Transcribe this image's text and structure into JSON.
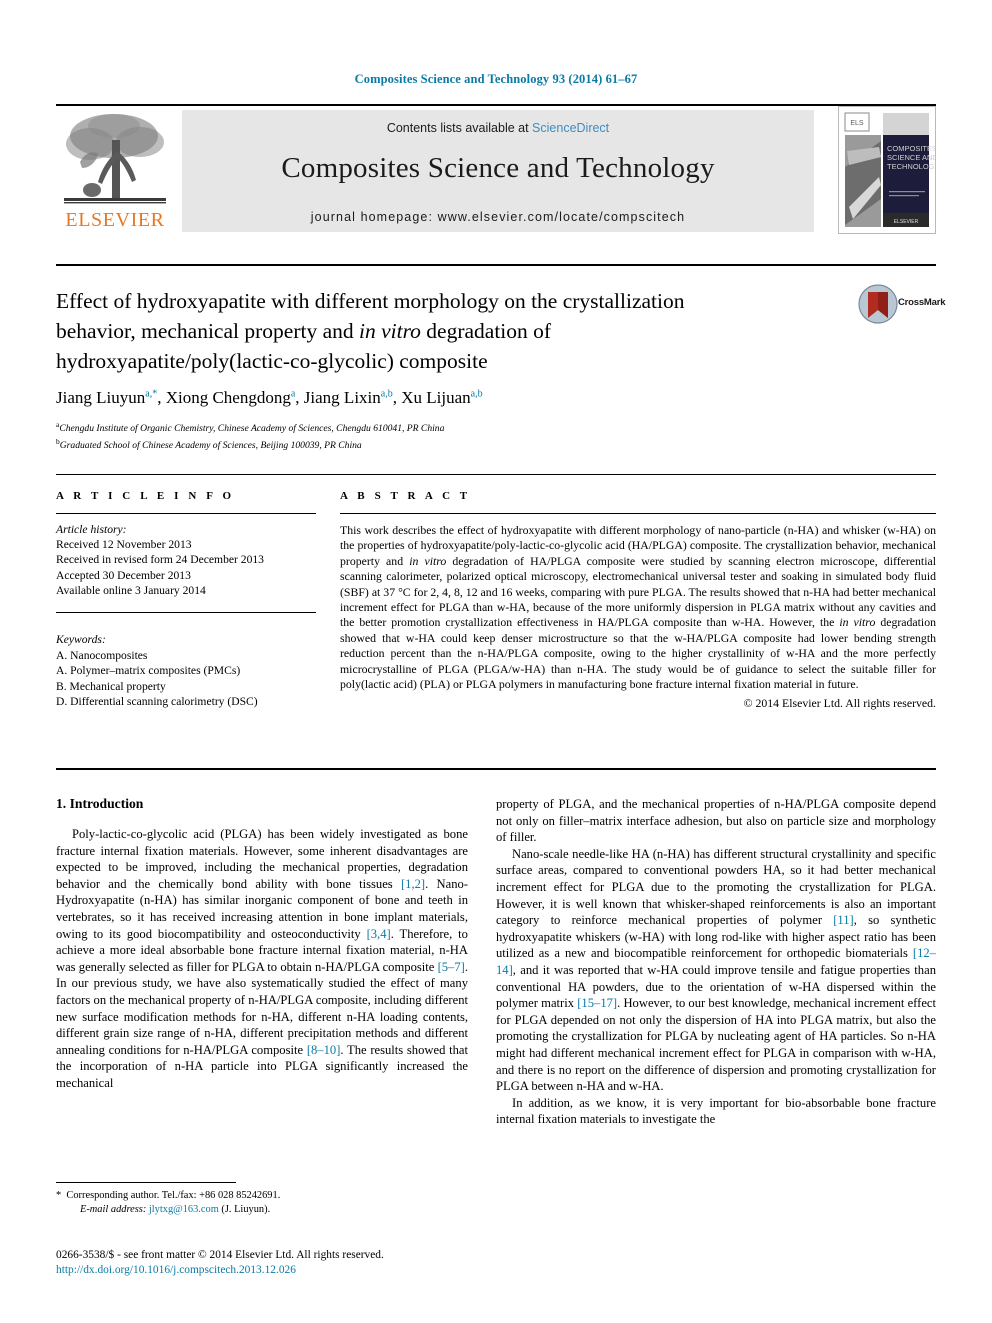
{
  "running_head": "Composites Science and Technology 93 (2014) 61–67",
  "masthead": {
    "contents_prefix": "Contents lists available at ",
    "sciencedirect": "ScienceDirect",
    "journal_title": "Composites Science and Technology",
    "homepage": "journal homepage: www.elsevier.com/locate/compscitech",
    "publisher_logo_text": "ELSEVIER",
    "cover_title": "COMPOSITES SCIENCE AND TECHNOLOGY"
  },
  "article": {
    "title_line1": "Effect of hydroxyapatite with different morphology on the crystallization",
    "title_line2_a": "behavior, mechanical property and ",
    "title_line2_i": "in vitro",
    "title_line2_b": " degradation of",
    "title_line3": "hydroxyapatite/poly(lactic-co-glycolic) composite",
    "crossmark_label": "CrossMark",
    "authors": [
      {
        "name": "Jiang Liuyun",
        "marks": "a,*"
      },
      {
        "name": "Xiong Chengdong",
        "marks": "a"
      },
      {
        "name": "Jiang Lixin",
        "marks": "a,b"
      },
      {
        "name": "Xu Lijuan",
        "marks": "a,b"
      }
    ],
    "affiliations": [
      {
        "mark": "a",
        "text": "Chengdu Institute of Organic Chemistry, Chinese Academy of Sciences, Chengdu 610041, PR China"
      },
      {
        "mark": "b",
        "text": "Graduated School of Chinese Academy of Sciences, Beijing 100039, PR China"
      }
    ]
  },
  "article_info": {
    "heading": "A R T I C L E    I N F O",
    "history_label": "Article history:",
    "history": [
      "Received 12 November 2013",
      "Received in revised form 24 December 2013",
      "Accepted 30 December 2013",
      "Available online 3 January 2014"
    ],
    "keywords_label": "Keywords:",
    "keywords": [
      "A. Nanocomposites",
      "A. Polymer–matrix composites (PMCs)",
      "B. Mechanical property",
      "D. Differential scanning calorimetry (DSC)"
    ]
  },
  "abstract": {
    "heading": "A B S T R A C T",
    "part1": "This work describes the effect of hydroxyapatite with different morphology of nano-particle (n-HA) and whisker (w-HA) on the properties of hydroxyapatite/poly-lactic-co-glycolic acid (HA/PLGA) composite. The crystallization behavior, mechanical property and ",
    "italic1": "in vitro",
    "part2": " degradation of HA/PLGA composite were studied by scanning electron microscope, differential scanning calorimeter, polarized optical microscopy, electromechanical universal tester and soaking in simulated body fluid (SBF) at 37 °C for 2, 4, 8, 12 and 16 weeks, comparing with pure PLGA. The results showed that n-HA had better mechanical increment effect for PLGA than w-HA, because of the more uniformly dispersion in PLGA matrix without any cavities and the better promotion crystallization effectiveness in HA/PLGA composite than w-HA. However, the ",
    "italic2": "in vitro",
    "part3": " degradation showed that w-HA could keep denser microstructure so that the w-HA/PLGA composite had lower bending strength reduction percent than the n-HA/PLGA composite, owing to the higher crystallinity of w-HA and the more perfectly microcrystalline of PLGA (PLGA/w-HA) than n-HA. The study would be of guidance to select the suitable filler for poly(lactic acid) (PLA) or PLGA polymers in manufacturing bone fracture internal fixation material in future.",
    "copyright": "© 2014 Elsevier Ltd. All rights reserved."
  },
  "body": {
    "section_heading": "1. Introduction",
    "left_paragraphs": [
      {
        "segments": [
          {
            "t": "Poly-lactic-co-glycolic acid (PLGA) has been widely investigated as bone fracture internal fixation materials. However, some inherent disadvantages are expected to be improved, including the mechanical properties, degradation behavior and the chemically bond ability with bone tissues "
          },
          {
            "t": "[1,2]",
            "k": "ref"
          },
          {
            "t": ". Nano-Hydroxyapatite (n-HA) has similar inorganic component of bone and teeth in vertebrates, so it has received increasing attention in bone implant materials, owing to its good biocompatibility and osteoconductivity "
          },
          {
            "t": "[3,4]",
            "k": "ref"
          },
          {
            "t": ". Therefore, to achieve a more ideal absorbable bone fracture internal fixation material, n-HA was generally selected as filler for PLGA to obtain n-HA/PLGA composite "
          },
          {
            "t": "[5–7]",
            "k": "ref"
          },
          {
            "t": ". In our previous study, we have also systematically studied the effect of many factors on the mechanical property of n-HA/PLGA composite, including different new surface modification methods for n-HA, different n-HA loading contents, different grain size range of n-HA, different precipitation methods and different annealing conditions for n-HA/PLGA composite "
          },
          {
            "t": "[8–10]",
            "k": "ref"
          },
          {
            "t": ". The results showed that the incorporation of n-HA particle into PLGA significantly increased the mechanical"
          }
        ]
      }
    ],
    "right_paragraphs": [
      {
        "indent": false,
        "segments": [
          {
            "t": "property of PLGA, and the mechanical properties of n-HA/PLGA composite depend not only on filler–matrix interface adhesion, but also on particle size and morphology of filler."
          }
        ]
      },
      {
        "indent": true,
        "segments": [
          {
            "t": "Nano-scale needle-like HA (n-HA) has different structural crystallinity and specific surface areas, compared to conventional powders HA, so it had better mechanical increment effect for PLGA due to the promoting the crystallization for PLGA. However, it is well known that whisker-shaped reinforcements is also an important category to reinforce mechanical properties of polymer "
          },
          {
            "t": "[11]",
            "k": "ref"
          },
          {
            "t": ", so synthetic hydroxyapatite whiskers (w-HA) with long rod-like with higher aspect ratio has been utilized as a new and biocompatible reinforcement for orthopedic biomaterials "
          },
          {
            "t": "[12–14]",
            "k": "ref"
          },
          {
            "t": ", and it was reported that w-HA could improve tensile and fatigue properties than conventional HA powders, due to the orientation of w-HA dispersed within the polymer matrix "
          },
          {
            "t": "[15–17]",
            "k": "ref"
          },
          {
            "t": ". However, to our best knowledge, mechanical increment effect for PLGA depended on not only the dispersion of HA into PLGA matrix, but also the promoting the crystallization for PLGA by nucleating agent of HA particles. So n-HA might had different mechanical increment effect for PLGA in comparison with w-HA, and there is no report on the difference of dispersion and promoting crystallization for PLGA between n-HA and w-HA."
          }
        ]
      },
      {
        "indent": true,
        "segments": [
          {
            "t": "In addition, as we know, it is very important for bio-absorbable bone fracture internal fixation materials to investigate the"
          }
        ]
      }
    ]
  },
  "footnote": {
    "star": "*",
    "corresponding": "Corresponding author. Tel./fax: +86 028 85242691.",
    "email_label": "E-mail address:",
    "email": "jlytxg@163.com",
    "email_owner": "(J. Liuyun)."
  },
  "imprint": {
    "line1": "0266-3538/$ - see front matter © 2014 Elsevier Ltd. All rights reserved.",
    "doi": "http://dx.doi.org/10.1016/j.compscitech.2013.12.026"
  },
  "colors": {
    "header_teal": "#0b7aa5",
    "link_blue": "#3d8dc4",
    "elsevier_orange": "#e87722",
    "band_gray": "#e6e6e6"
  }
}
